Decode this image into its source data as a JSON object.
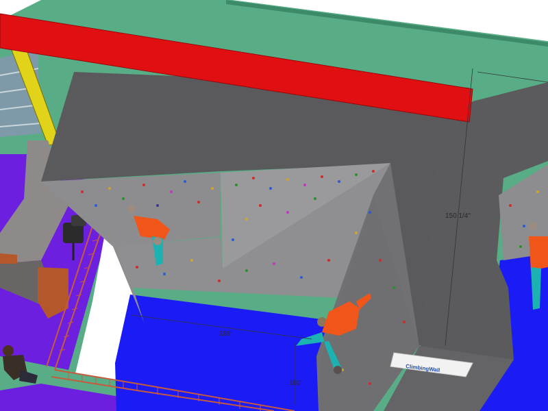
{
  "dimensions": {
    "height": "150 1/4\"",
    "width": "189\"",
    "depth": "102\""
  },
  "logo": {
    "text": "ClimbingWall"
  },
  "colors": {
    "wall_top": "#5a5a5c",
    "panel": "#8d8d8f",
    "floor_mat": "#1b1bf5",
    "green_wall": "#58ad86",
    "red_beam": "#e00f12",
    "purple_carpet": "#6d1fe0",
    "climber_shirt": "#f0561a",
    "climber_pants": "#1cb2b2"
  }
}
